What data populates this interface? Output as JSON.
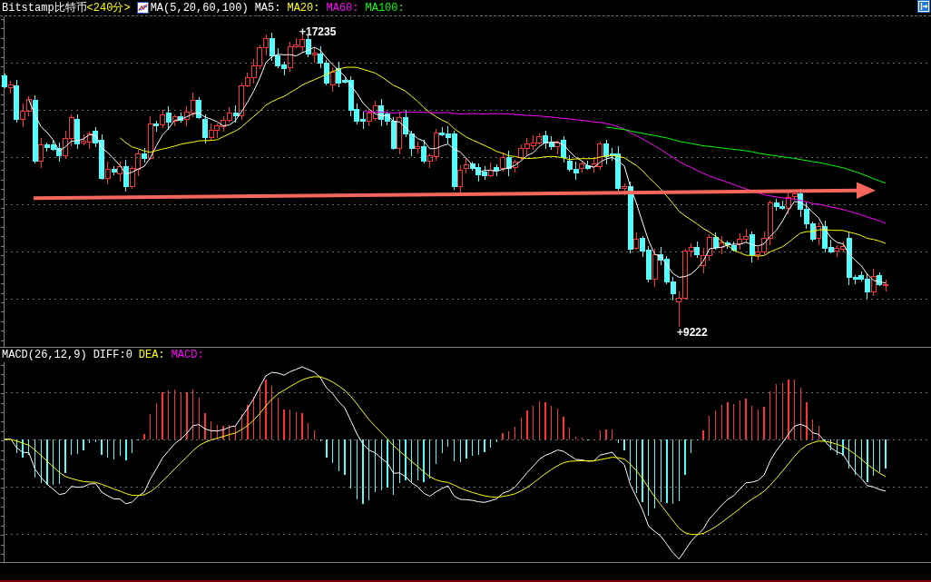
{
  "header": {
    "symbol": "Bitstamp比特币",
    "period": "<240分>",
    "indicator": "MA(5,20,60,100)",
    "ma_legend": [
      {
        "label": "MA5:",
        "color": "#ffffff"
      },
      {
        "label": "MA20:",
        "color": "#ffff00"
      },
      {
        "label": "MA60:",
        "color": "#ff00ff"
      },
      {
        "label": "MA100:",
        "color": "#00ff00"
      }
    ]
  },
  "price_panel": {
    "high_label": "+17235",
    "low_label": "+9222"
  },
  "macd_panel": {
    "indicator": "MACD(26,12,9)",
    "legend": [
      {
        "label": "DIFF:0",
        "color": "#ffffff"
      },
      {
        "label": "DEA:",
        "color": "#ffff00"
      },
      {
        "label": "MACD:",
        "color": "#ff00ff"
      }
    ]
  }
}
